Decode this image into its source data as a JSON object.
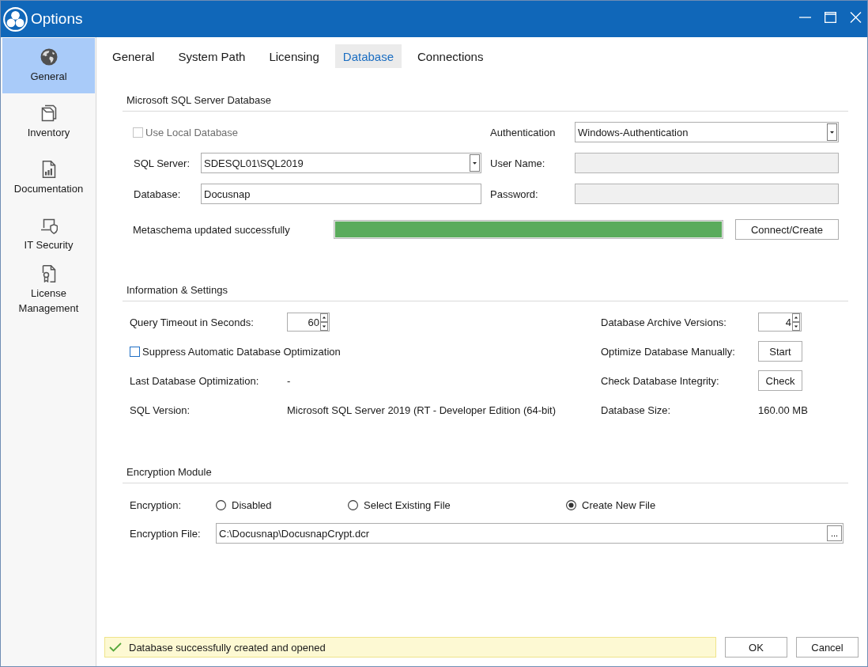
{
  "window": {
    "title": "Options"
  },
  "sidebar": {
    "items": [
      {
        "label": "General",
        "selected": true
      },
      {
        "label": "Inventory",
        "selected": false
      },
      {
        "label": "Documentation",
        "selected": false
      },
      {
        "label": "IT Security",
        "selected": false
      },
      {
        "label": "License Management",
        "selected": false
      }
    ]
  },
  "tabs": [
    {
      "label": "General",
      "selected": false
    },
    {
      "label": "System Path",
      "selected": false
    },
    {
      "label": "Licensing",
      "selected": false
    },
    {
      "label": "Database",
      "selected": true
    },
    {
      "label": "Connections",
      "selected": false
    }
  ],
  "database_section": {
    "title": "Microsoft SQL Server Database",
    "use_local_database": {
      "label": "Use Local Database",
      "checked": false,
      "disabled": true
    },
    "authentication": {
      "label": "Authentication",
      "value": "Windows-Authentication"
    },
    "sql_server": {
      "label": "SQL Server:",
      "value": "SDESQL01\\SQL2019"
    },
    "user_name": {
      "label": "User Name:",
      "disabled": true
    },
    "database": {
      "label": "Database:",
      "value": "Docusnap"
    },
    "password": {
      "label": "Password:",
      "disabled": true
    },
    "progress": {
      "status": "Metaschema updated successfully",
      "level": 1
    },
    "connect_button": "Connect/Create"
  },
  "info_section": {
    "title": "Information & Settings",
    "query_timeout": {
      "label": "Query Timeout in Seconds:",
      "value": "60"
    },
    "archive_versions": {
      "label": "Database Archive Versions:",
      "value": "4"
    },
    "suppress_optimization": {
      "label": "Suppress Automatic Database Optimization",
      "checked": false,
      "disabled": false
    },
    "optimize_manually": {
      "label": "Optimize Database Manually:",
      "button": "Start"
    },
    "last_optimization": {
      "label": "Last Database Optimization:",
      "value": "-"
    },
    "check_integrity": {
      "label": "Check Database Integrity:",
      "button": "Check"
    },
    "sql_version": {
      "label": "SQL Version:",
      "value": "Microsoft SQL Server 2019 (RT - Developer Edition (64-bit)"
    },
    "database_size": {
      "label": "Database Size:",
      "value": "160.00 MB"
    }
  },
  "encryption_section": {
    "title": "Encryption Module",
    "encryption": {
      "label": "Encryption:",
      "options": [
        {
          "label": "Disabled",
          "selected": false
        },
        {
          "label": "Select Existing File",
          "selected": false
        },
        {
          "label": "Create New File",
          "selected": true
        }
      ]
    },
    "encryption_file": {
      "label": "Encryption File:",
      "value": "C:\\Docusnap\\DocusnapCrypt.dcr",
      "browse_button": "..."
    }
  },
  "status_bar": {
    "message": "Database successfully created and opened"
  },
  "buttons": [
    "OK",
    "Cancel"
  ]
}
